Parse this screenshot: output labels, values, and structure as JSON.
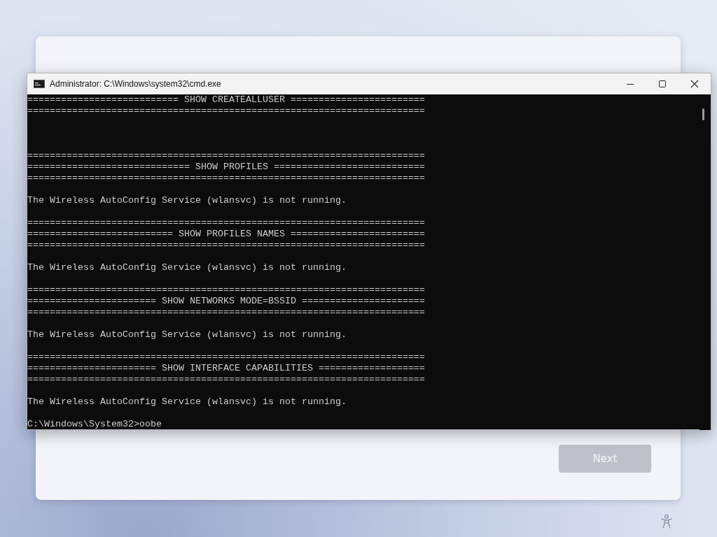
{
  "setup": {
    "next_button": {
      "label": "Next",
      "disabled": true
    }
  },
  "cmd_window": {
    "title": "Administrator: C:\\Windows\\system32\\cmd.exe",
    "console_lines": [
      {
        "kind": "text",
        "text": "=========================== SHOW CREATEALLUSER ========================"
      },
      {
        "kind": "text",
        "text": "======================================================================="
      },
      {
        "kind": "blank"
      },
      {
        "kind": "blank"
      },
      {
        "kind": "blank"
      },
      {
        "kind": "text",
        "text": "======================================================================="
      },
      {
        "kind": "text",
        "text": "============================= SHOW PROFILES ==========================="
      },
      {
        "kind": "text",
        "text": "======================================================================="
      },
      {
        "kind": "blank"
      },
      {
        "kind": "text",
        "text": "The Wireless AutoConfig Service (wlansvc) is not running."
      },
      {
        "kind": "blank"
      },
      {
        "kind": "text",
        "text": "======================================================================="
      },
      {
        "kind": "text",
        "text": "========================== SHOW PROFILES NAMES ========================"
      },
      {
        "kind": "text",
        "text": "======================================================================="
      },
      {
        "kind": "blank"
      },
      {
        "kind": "text",
        "text": "The Wireless AutoConfig Service (wlansvc) is not running."
      },
      {
        "kind": "blank"
      },
      {
        "kind": "text",
        "text": "======================================================================="
      },
      {
        "kind": "text",
        "text": "======================= SHOW NETWORKS MODE=BSSID ======================"
      },
      {
        "kind": "text",
        "text": "======================================================================="
      },
      {
        "kind": "blank"
      },
      {
        "kind": "text",
        "text": "The Wireless AutoConfig Service (wlansvc) is not running."
      },
      {
        "kind": "blank"
      },
      {
        "kind": "text",
        "text": "======================================================================="
      },
      {
        "kind": "text",
        "text": "======================= SHOW INTERFACE CAPABILITIES ==================="
      },
      {
        "kind": "text",
        "text": "======================================================================="
      },
      {
        "kind": "blank"
      },
      {
        "kind": "text",
        "text": "The Wireless AutoConfig Service (wlansvc) is not running."
      },
      {
        "kind": "blank"
      },
      {
        "kind": "prompt",
        "text": "C:\\Windows\\System32>oobe"
      }
    ]
  }
}
